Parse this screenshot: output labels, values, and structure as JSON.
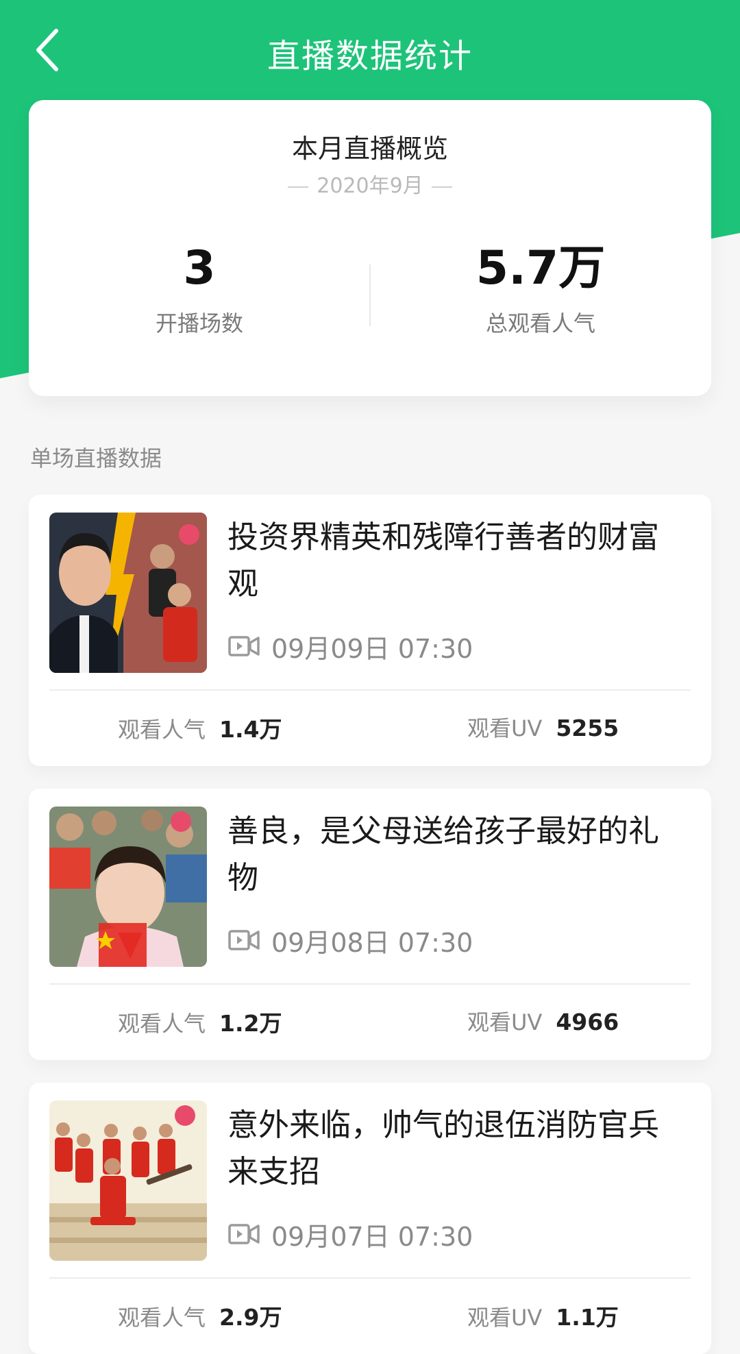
{
  "header": {
    "title": "直播数据统计",
    "back_icon": "chevron-left-icon"
  },
  "overview": {
    "title": "本月直播概览",
    "month": "2020年9月",
    "stats": [
      {
        "value": "3",
        "label": "开播场数"
      },
      {
        "value": "5.7万",
        "label": "总观看人气"
      }
    ]
  },
  "section_label": "单场直播数据",
  "sessions": [
    {
      "title": "投资界精英和残障行善者的财富观",
      "datetime": "09月09日 07:30",
      "popularity_label": "观看人气",
      "popularity": "1.4万",
      "uv_label": "观看UV",
      "uv": "5255"
    },
    {
      "title": "善良，是父母送给孩子最好的礼物",
      "datetime": "09月08日 07:30",
      "popularity_label": "观看人气",
      "popularity": "1.2万",
      "uv_label": "观看UV",
      "uv": "4966"
    },
    {
      "title": "意外来临，帅气的退伍消防官兵来支招",
      "datetime": "09月07日 07:30",
      "popularity_label": "观看人气",
      "popularity": "2.9万",
      "uv_label": "观看UV",
      "uv": "1.1万"
    }
  ],
  "colors": {
    "brand_green": "#1dc379"
  }
}
